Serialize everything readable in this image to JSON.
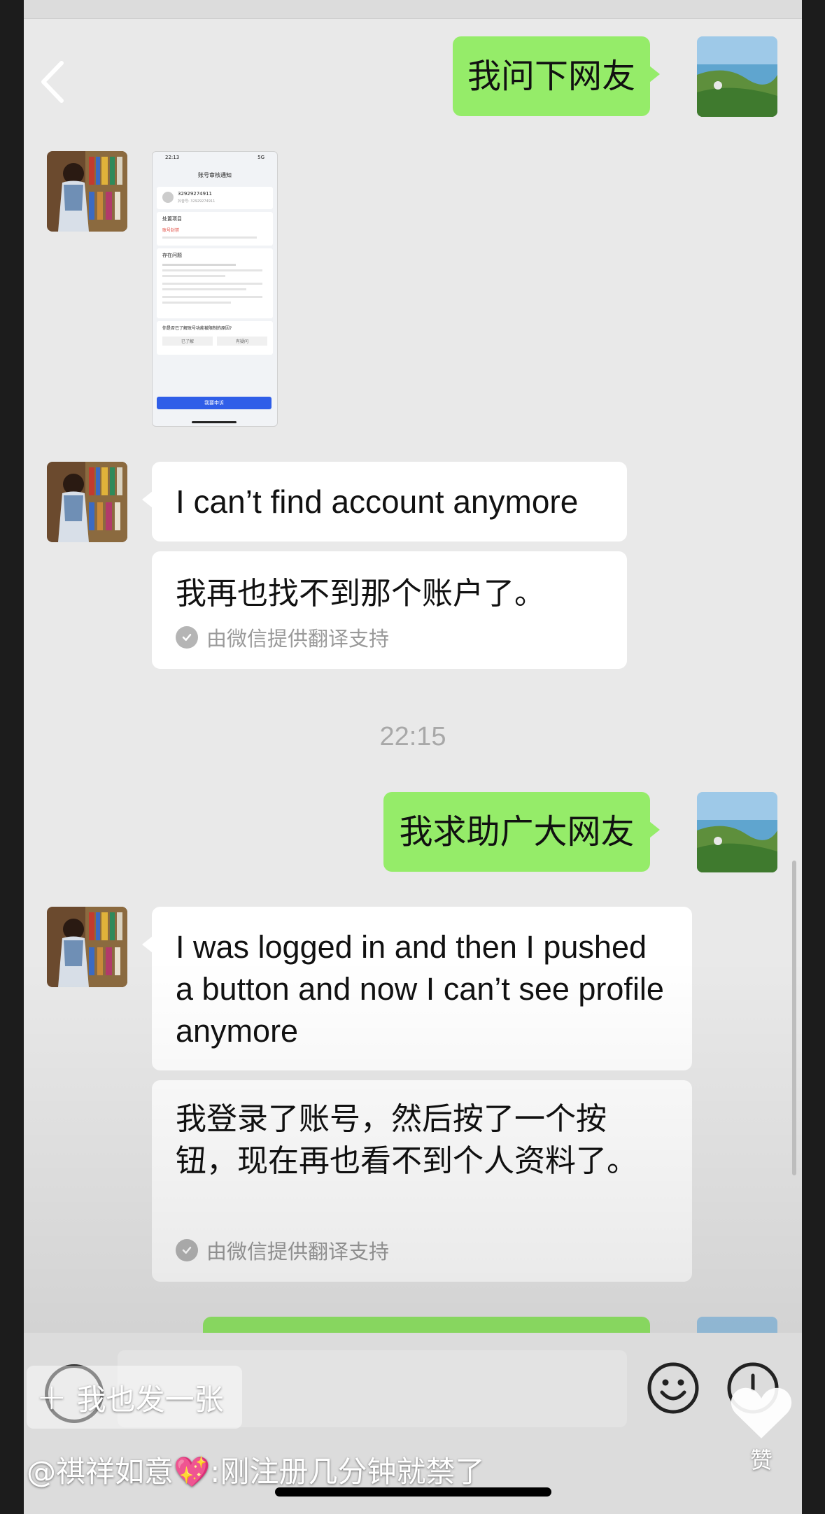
{
  "chat": {
    "messages": {
      "m1": "我问下网友",
      "m3_en": "I can’t find account anymore",
      "m3_cn": "我再也找不到那个账户了。",
      "time": "22:15",
      "m4": "我求助广大网友",
      "m5_en": "I was logged in and then I pushed a button and now I can’t see profile anymore",
      "m5_cn": "我登录了账号，然后按了一个按钮，现在再也看不到个人资料了。"
    },
    "translation_note": "由微信提供翻译支持"
  },
  "screenshot": {
    "time": "22:13",
    "status": "5G",
    "title": "账号审核通知",
    "account_id": "32929274911",
    "sub_id": "抖音号: 32929274911",
    "section1": "处置项目",
    "status_red": "账号封禁",
    "section2": "存在问题",
    "question": "你是否已了解账号功能被限制的原因?",
    "opt1": "已了解",
    "opt2": "有疑问",
    "button": "我要申诉"
  },
  "overlay": {
    "share_label": "我也发一张",
    "caption": "@祺祥如意💖:刚注册几分钟就禁了",
    "like_label": "赞"
  },
  "colors": {
    "me_bubble": "#95ec69",
    "other_bubble": "#ffffff",
    "background": "#e9e9e9",
    "ban_red": "#e0453b",
    "appeal_blue": "#2f5ee8"
  },
  "icons": [
    "back-chevron-icon",
    "voice-icon",
    "emoji-icon",
    "plus-circle-icon",
    "heart-icon",
    "check-icon"
  ]
}
